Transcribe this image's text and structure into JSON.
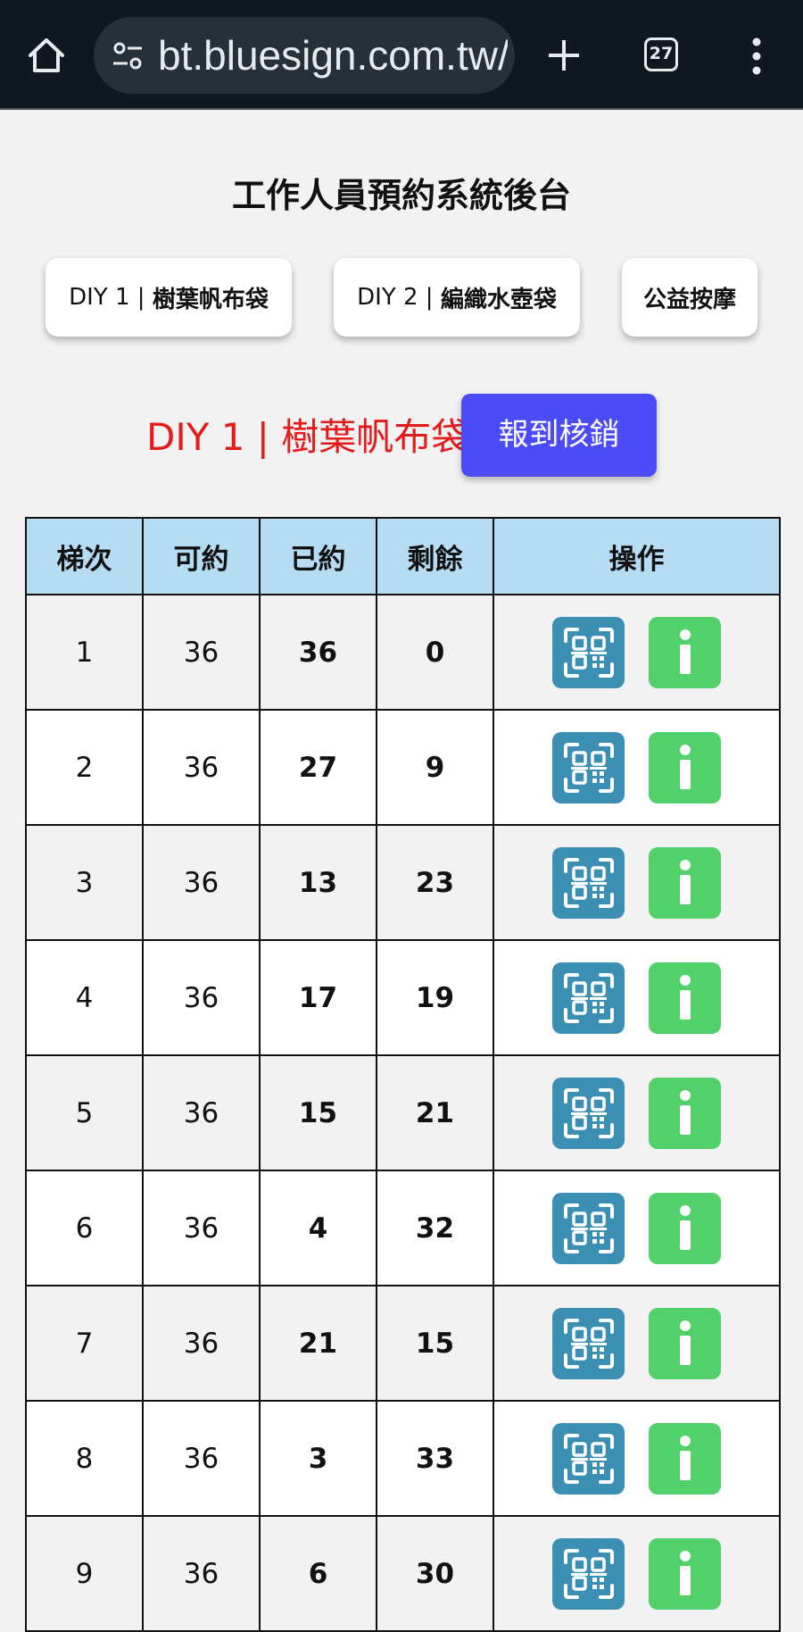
{
  "browser": {
    "url": "bt.bluesign.com.tw/s",
    "tab_count": "27"
  },
  "page": {
    "title": "工作人員預約系統後台"
  },
  "tabs": [
    {
      "prefix": "DIY 1 | ",
      "name": "樹葉帆布袋"
    },
    {
      "prefix": "DIY 2 | ",
      "name": "編織水壺袋"
    },
    {
      "prefix": "",
      "name": "公益按摩"
    }
  ],
  "section": {
    "title": "DIY 1 | 樹葉帆布袋",
    "checkin_label": "報到核銷"
  },
  "table": {
    "headers": [
      "梯次",
      "可約",
      "已約",
      "剩餘",
      "操作"
    ],
    "rows": [
      {
        "session": "1",
        "capacity": "36",
        "booked": "36",
        "remaining": "0"
      },
      {
        "session": "2",
        "capacity": "36",
        "booked": "27",
        "remaining": "9"
      },
      {
        "session": "3",
        "capacity": "36",
        "booked": "13",
        "remaining": "23"
      },
      {
        "session": "4",
        "capacity": "36",
        "booked": "17",
        "remaining": "19"
      },
      {
        "session": "5",
        "capacity": "36",
        "booked": "15",
        "remaining": "21"
      },
      {
        "session": "6",
        "capacity": "36",
        "booked": "4",
        "remaining": "32"
      },
      {
        "session": "7",
        "capacity": "36",
        "booked": "21",
        "remaining": "15"
      },
      {
        "session": "8",
        "capacity": "36",
        "booked": "3",
        "remaining": "33"
      },
      {
        "session": "9",
        "capacity": "36",
        "booked": "6",
        "remaining": "30"
      }
    ]
  },
  "icons": {
    "scan": "qr-scan-icon",
    "info": "info-icon"
  },
  "colors": {
    "accent_red": "#e41b1b",
    "checkin_blue": "#4b4cf7",
    "header_blue": "#b6dcf4",
    "scan_button": "#3a8fb2",
    "info_button": "#52d06b"
  }
}
